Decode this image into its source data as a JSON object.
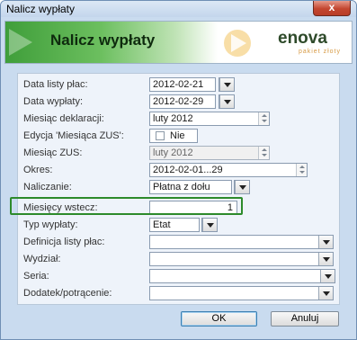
{
  "window": {
    "title": "Nalicz wypłaty",
    "close_label": "x"
  },
  "banner": {
    "title": "Nalicz wypłaty",
    "logo_text": "enova",
    "logo_sub": "pakiet złoty"
  },
  "fields": {
    "data_listy_plac": {
      "label": "Data listy płac:",
      "value": "2012-02-21"
    },
    "data_wyplaty": {
      "label": "Data wypłaty:",
      "value": "2012-02-29"
    },
    "miesiac_deklaracji": {
      "label": "Miesiąc deklaracji:",
      "value": "luty 2012"
    },
    "edycja_miesiaca_zus": {
      "label": "Edycja 'Miesiąca ZUS':",
      "value": "Nie",
      "checked": false
    },
    "miesiac_zus": {
      "label": "Miesiąc ZUS:",
      "value": "luty 2012"
    },
    "okres": {
      "label": "Okres:",
      "value": "2012-02-01...29"
    },
    "naliczanie": {
      "label": "Naliczanie:",
      "value": "Płatna z dołu"
    },
    "miesiecy_wstecz": {
      "label": "Miesięcy wstecz:",
      "value": "1"
    },
    "typ_wyplaty": {
      "label": "Typ wypłaty:",
      "value": "Etat"
    },
    "definicja_listy_plac": {
      "label": "Definicja listy płac:",
      "value": ""
    },
    "wydzial": {
      "label": "Wydział:",
      "value": ""
    },
    "seria": {
      "label": "Seria:",
      "value": ""
    },
    "dodatek_potracenie": {
      "label": "Dodatek/potrącenie:",
      "value": ""
    }
  },
  "buttons": {
    "ok": "OK",
    "cancel": "Anuluj"
  },
  "colors": {
    "highlight": "#2d8a2b",
    "banner_green": "#3f9e3a",
    "close": "#c3462f"
  }
}
